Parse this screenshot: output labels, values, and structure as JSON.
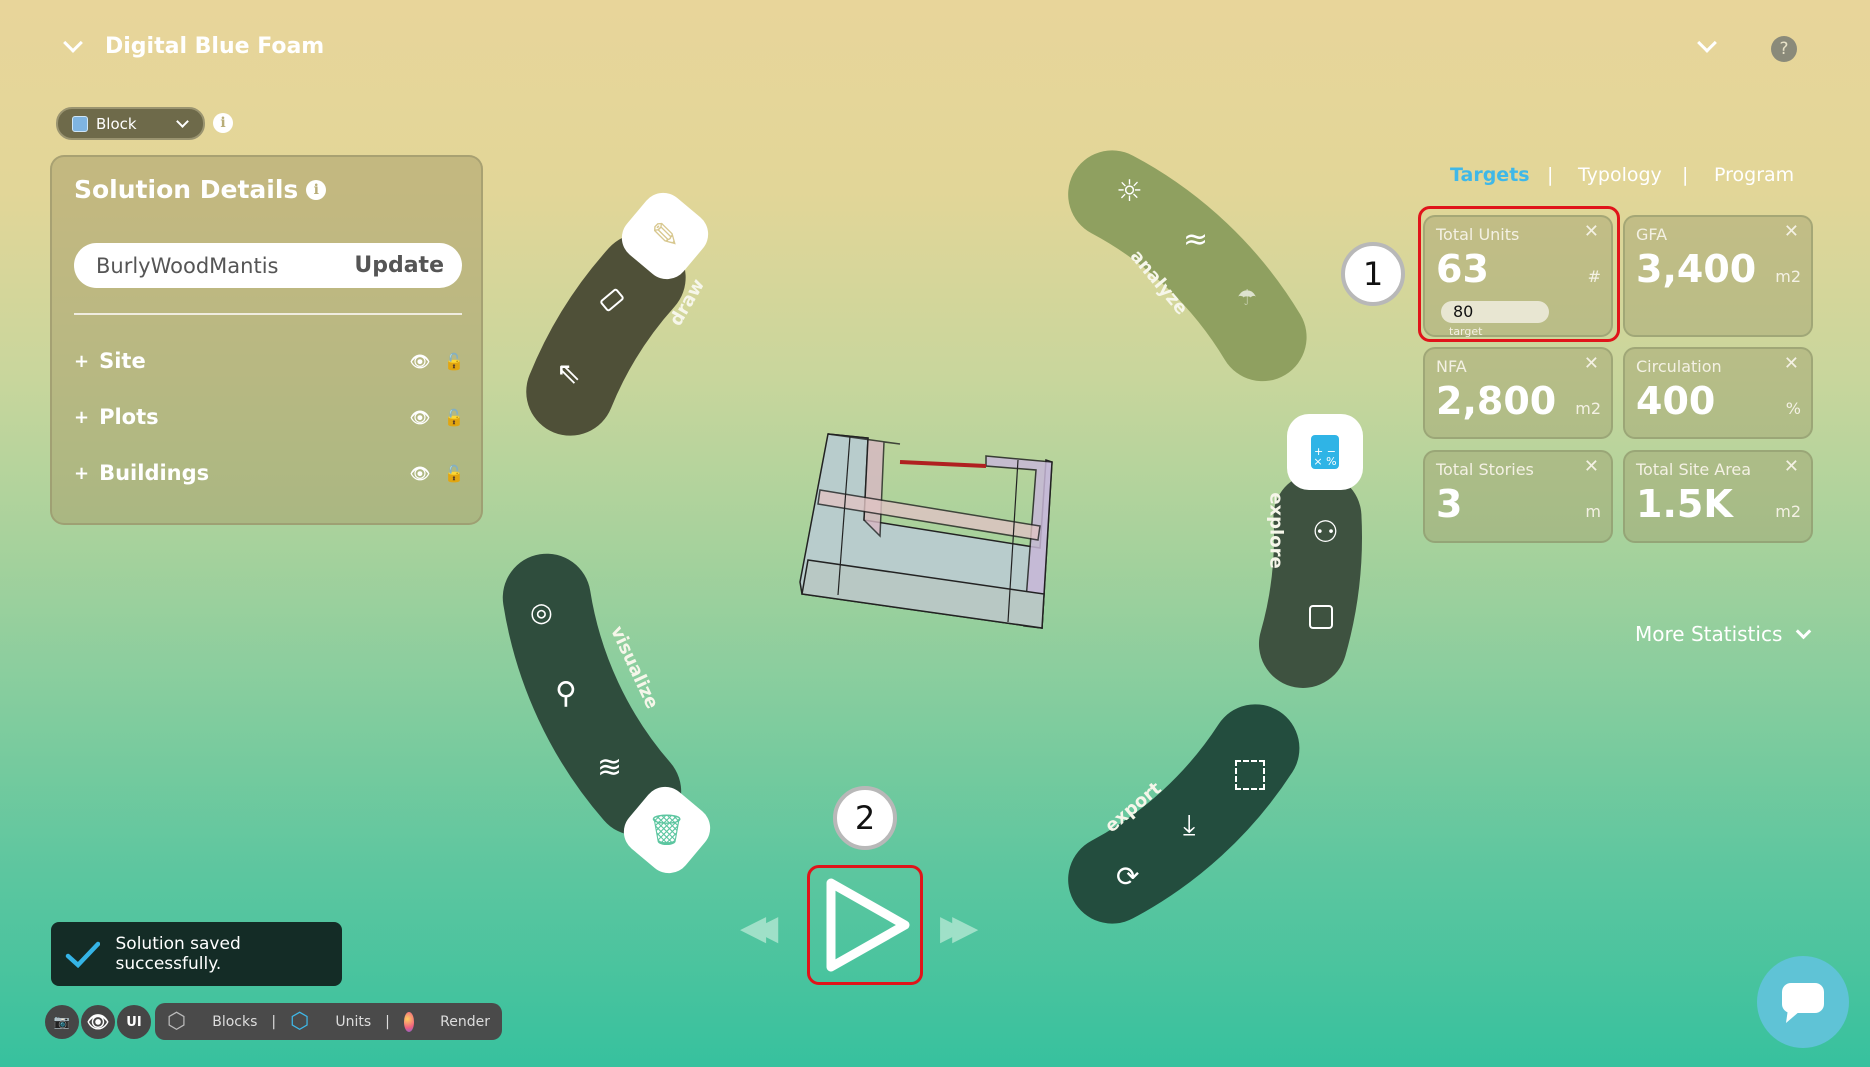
{
  "header": {
    "title": "Digital Blue Foam",
    "help": "?"
  },
  "mode_select": {
    "value": "Block"
  },
  "solution": {
    "title": "Solution Details",
    "name_value": "BurlyWoodMantis",
    "update_label": "Update",
    "rows": [
      {
        "label": "Site"
      },
      {
        "label": "Plots"
      },
      {
        "label": "Buildings"
      }
    ],
    "expand_symbol": "+"
  },
  "tabs": [
    {
      "label": "Targets",
      "active": true
    },
    {
      "label": "Typology"
    },
    {
      "label": "Program"
    }
  ],
  "tab_separator": "|",
  "cards": [
    {
      "title": "Total Units",
      "value": "63",
      "unit": "#",
      "target": "80",
      "target_label": "target"
    },
    {
      "title": "GFA",
      "value": "3,400",
      "unit": "m2"
    },
    {
      "title": "NFA",
      "value": "2,800",
      "unit": "m2"
    },
    {
      "title": "Circulation",
      "value": "400",
      "unit": "%"
    },
    {
      "title": "Total Stories",
      "value": "3",
      "unit": "m"
    },
    {
      "title": "Total Site Area",
      "value": "1.5K",
      "unit": "m2"
    }
  ],
  "annotations": {
    "one": "1",
    "two": "2"
  },
  "more_statistics": "More Statistics",
  "radial_menu": {
    "draw": "draw",
    "analyze": "analyze",
    "explore": "explore",
    "export": "export",
    "visualize": "visualize"
  },
  "toast": {
    "message": "Solution saved successfully."
  },
  "toolbar": {
    "ui": "UI",
    "blocks": "Blocks",
    "units": "Units",
    "render": "Render",
    "sep": "|"
  },
  "colors": {
    "accent": "#3fb8e8",
    "highlight": "#e0141a",
    "toast_bg": "#142c26",
    "draw": "#4f5038",
    "analyze": "#8fa060",
    "explore": "#3e5240",
    "export": "#234d3e",
    "visualize": "#2f4d3d"
  }
}
